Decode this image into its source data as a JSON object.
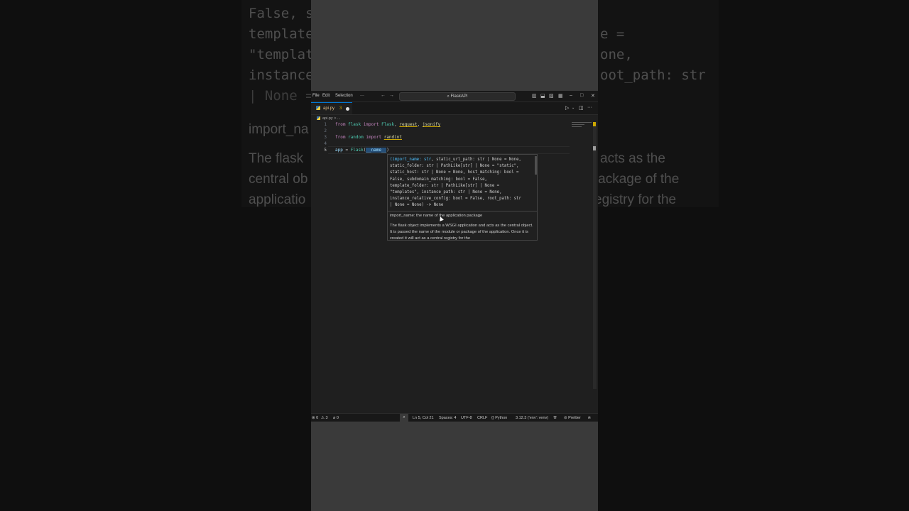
{
  "background_zoom": {
    "lines": [
      "False, st",
      "template_",
      "\"templat",
      "instance",
      "| None =",
      "e =",
      "one,",
      "oot_path: str"
    ],
    "para_lines": [
      "import_na",
      "The flask",
      "central ob",
      "applicatio",
      "acts as the",
      "r package of the",
      "egistry for the"
    ]
  },
  "titlebar": {
    "menu": [
      "File",
      "Edit",
      "Selection",
      "···"
    ],
    "back": "←",
    "forward": "→",
    "search_text": "⌕ FlaskAPI",
    "layout_icons": [
      "▥",
      "⬓",
      "▨",
      "▦"
    ],
    "window_controls": [
      "–",
      "□",
      "✕"
    ]
  },
  "tab": {
    "filename": "api.py",
    "problems": "3"
  },
  "tab_actions": [
    "▷",
    "⌄",
    "◫",
    "···"
  ],
  "breadcrumb": {
    "file": "api.py",
    "rest": "> ..."
  },
  "editor": {
    "line_numbers": [
      "1",
      "2",
      "3",
      "4",
      "5"
    ],
    "line1": {
      "kw1": "from",
      "mod": "flask",
      "kw2": "import",
      "cls": "Flask",
      "sep1": ", ",
      "fn1": "request",
      "sep2": ", ",
      "fn2": "jsonify"
    },
    "line3": {
      "kw1": "from",
      "mod": "random",
      "kw2": "import",
      "fn": "randint"
    },
    "line5": {
      "var": "app",
      "eq": " = ",
      "cls": "Flask",
      "open": "(",
      "arg": "__name__",
      "close": ")"
    }
  },
  "signature_help": {
    "active_param": "(import_name: str",
    "signature_rest": ", static_url_path: str | None = None,\nstatic_folder: str | PathLike[str] | None = \"static\",\nstatic_host: str | None = None, host_matching: bool =\nFalse, subdomain_matching: bool = False,\ntemplate_folder: str | PathLike[str] | None =\n\"templates\", instance_path: str | None = None,\ninstance_relative_config: bool = False, root_path: str\n| None = None) -> None",
    "param_doc": "import_name: the name of the application package",
    "description": "The flask object implements a WSGI application and acts as the central object. It is passed the name of the module or package of the application. Once it is created it will act as a central registry for the"
  },
  "statusbar": {
    "errors": "⊗ 0",
    "warnings": "⚠ 3",
    "ports": "⌀ 0",
    "zoom_icon": "⌕",
    "position": "Ln 5, Col 21",
    "spaces": "Spaces: 4",
    "encoding": "UTF-8",
    "eol": "CRLF",
    "language": "{} Python",
    "interpreter": "3.12.3 ('env': venv)",
    "copilot": "⚒",
    "prettier": "⊘ Prettier",
    "bell": "⍾"
  },
  "colors": {
    "editor_bg": "#1f1f1f",
    "keyword": "#c586c0",
    "type": "#4ec9b0",
    "warning": "#cca700",
    "accent": "#0078d4"
  }
}
